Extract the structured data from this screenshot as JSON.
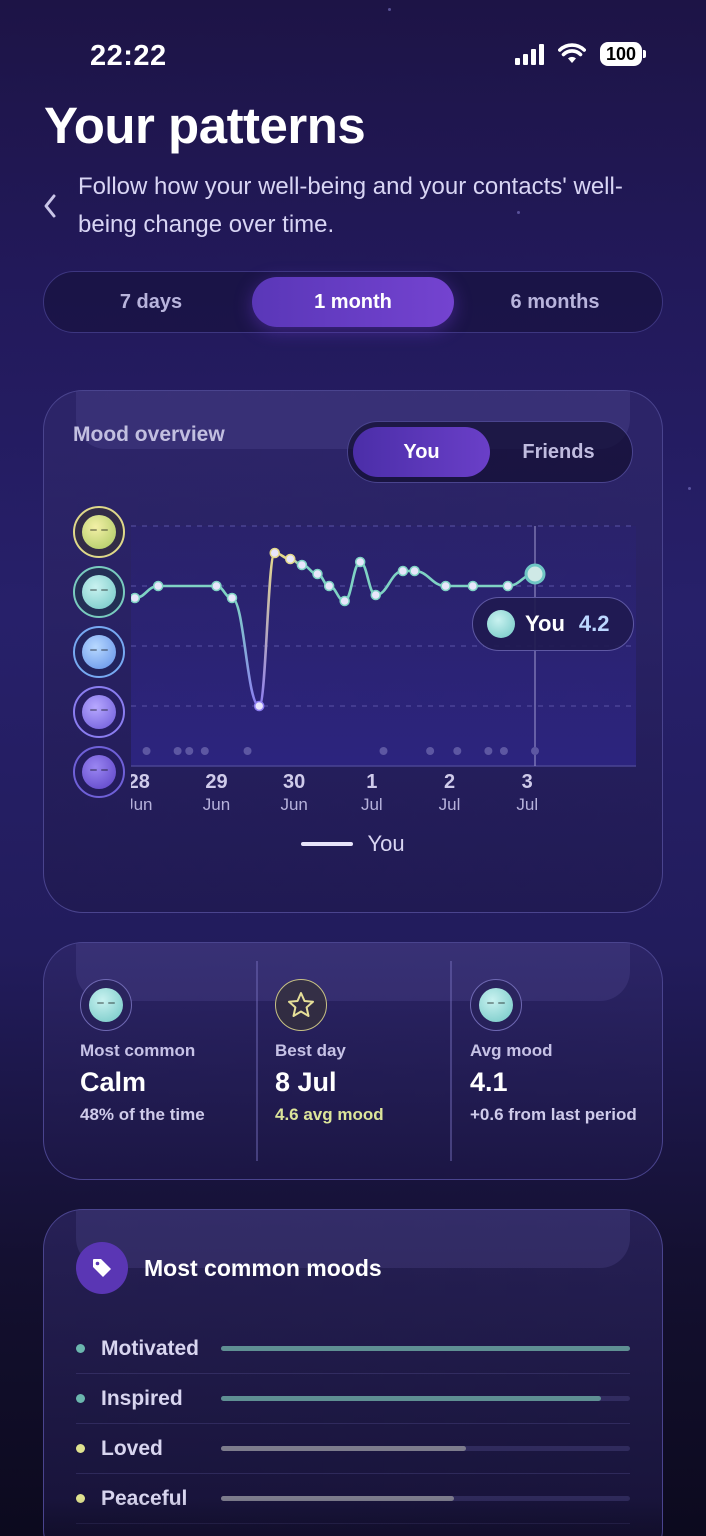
{
  "status_bar": {
    "time": "22:22",
    "battery": "100"
  },
  "header": {
    "title": "Your patterns",
    "subtitle": "Follow how your well-being and your contacts' well-being change over time."
  },
  "range_tabs": [
    {
      "label": "7 days",
      "active": false
    },
    {
      "label": "1 month",
      "active": true
    },
    {
      "label": "6 months",
      "active": false
    }
  ],
  "mood_overview": {
    "title": "Mood overview",
    "toggle": [
      {
        "label": "You",
        "active": true
      },
      {
        "label": "Friends",
        "active": false
      }
    ],
    "tooltip": {
      "label": "You",
      "value": "4.2"
    },
    "legend": "You"
  },
  "chart_data": {
    "type": "line",
    "title": "Mood overview",
    "x_tick_labels": [
      {
        "day": "28",
        "month": "Jun"
      },
      {
        "day": "29",
        "month": "Jun"
      },
      {
        "day": "30",
        "month": "Jun"
      },
      {
        "day": "1",
        "month": "Jul"
      },
      {
        "day": "2",
        "month": "Jul"
      },
      {
        "day": "3",
        "month": "Jul"
      }
    ],
    "xlim": [
      27.9,
      34.4
    ],
    "ylim": [
      1,
      5
    ],
    "y_levels": [
      1,
      2,
      3,
      4,
      5
    ],
    "series": [
      {
        "name": "You",
        "points": [
          {
            "x": 27.95,
            "y": 3.8
          },
          {
            "x": 28.25,
            "y": 4.0
          },
          {
            "x": 29.0,
            "y": 4.0
          },
          {
            "x": 29.2,
            "y": 3.8
          },
          {
            "x": 29.55,
            "y": 2.0
          },
          {
            "x": 29.75,
            "y": 4.55
          },
          {
            "x": 29.95,
            "y": 4.45
          },
          {
            "x": 30.1,
            "y": 4.35
          },
          {
            "x": 30.3,
            "y": 4.2
          },
          {
            "x": 30.45,
            "y": 4.0
          },
          {
            "x": 30.65,
            "y": 3.75
          },
          {
            "x": 30.85,
            "y": 4.4
          },
          {
            "x": 31.05,
            "y": 3.85
          },
          {
            "x": 31.4,
            "y": 4.25
          },
          {
            "x": 31.55,
            "y": 4.25
          },
          {
            "x": 31.95,
            "y": 4.0
          },
          {
            "x": 32.3,
            "y": 4.0
          },
          {
            "x": 32.75,
            "y": 4.0
          },
          {
            "x": 33.1,
            "y": 4.2
          }
        ]
      }
    ],
    "day_markers_x": [
      28.1,
      28.5,
      28.65,
      28.85,
      29.4,
      31.15,
      31.75,
      32.1,
      32.5,
      32.7,
      33.1
    ]
  },
  "stats": [
    {
      "label": "Most common",
      "value": "Calm",
      "sub": "48% of the time",
      "icon": "calm-face-icon"
    },
    {
      "label": "Best day",
      "value": "8 Jul",
      "sub": "4.6 avg mood",
      "icon": "star-icon"
    },
    {
      "label": "Avg mood",
      "value": "4.1",
      "sub": "+0.6 from last period",
      "icon": "calm-face-icon"
    }
  ],
  "common_moods": {
    "title": "Most common moods",
    "items": [
      {
        "name": "Motivated",
        "fraction": 1.0,
        "color": "#6bb6ae"
      },
      {
        "name": "Inspired",
        "fraction": 0.93,
        "color": "#6bb6ae"
      },
      {
        "name": "Loved",
        "fraction": 0.6,
        "color": "#dfe28f"
      },
      {
        "name": "Peaceful",
        "fraction": 0.57,
        "color": "#dfe28f"
      }
    ]
  },
  "colors": {
    "accent": "#6a3fc8",
    "line_teal": "#7fd3c4",
    "line_purple": "#8c7df0",
    "line_yellow": "#e4d98a"
  }
}
